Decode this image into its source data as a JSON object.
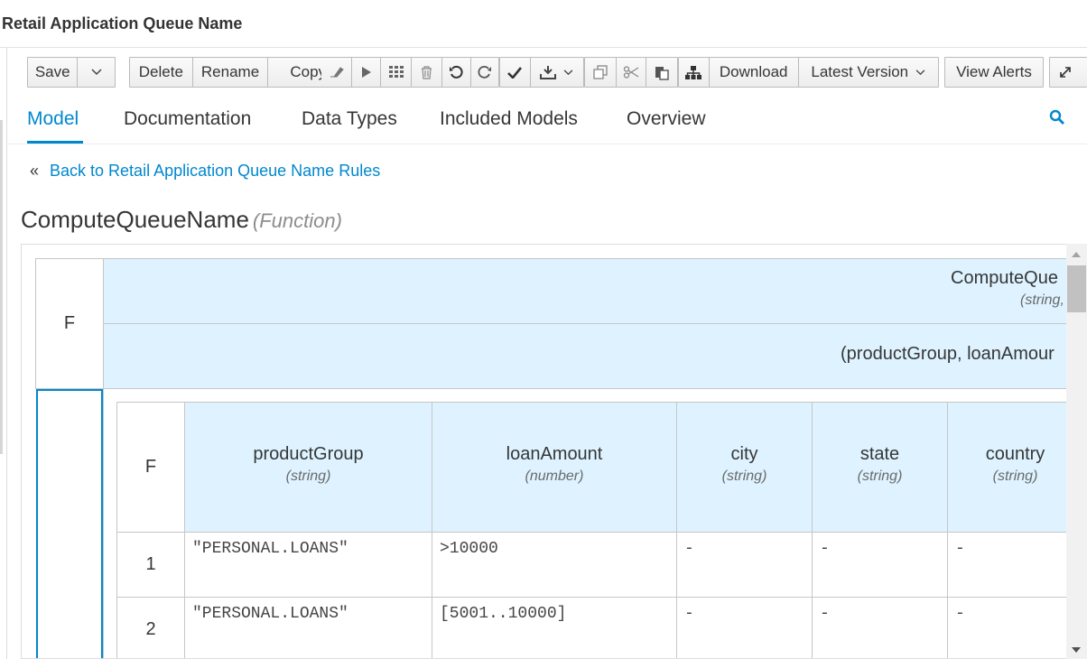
{
  "app": {
    "title": "Retail Application Queue Name"
  },
  "toolbar": {
    "save": "Save",
    "delete": "Delete",
    "rename": "Rename",
    "copy": "Copy",
    "download": "Download",
    "latest_version": "Latest Version",
    "view_alerts": "View Alerts"
  },
  "tabs": [
    {
      "label": "Model",
      "active": true
    },
    {
      "label": "Documentation"
    },
    {
      "label": "Data Types"
    },
    {
      "label": "Included Models"
    },
    {
      "label": "Overview"
    }
  ],
  "back_link": {
    "icon": "«",
    "label": "Back to Retail Application Queue Name Rules"
  },
  "function": {
    "name": "ComputeQueueName",
    "kind": "(Function)"
  },
  "editor": {
    "outer_hit_policy": "F",
    "outer_name": "ComputeQue",
    "outer_type": "(string,",
    "params": "(productGroup, loanAmour",
    "inner_hit_policy": "F",
    "columns": [
      {
        "name": "productGroup",
        "type": "(string)"
      },
      {
        "name": "loanAmount",
        "type": "(number)"
      },
      {
        "name": "city",
        "type": "(string)"
      },
      {
        "name": "state",
        "type": "(string)"
      },
      {
        "name": "country",
        "type": "(string)"
      }
    ],
    "rows": [
      {
        "index": "1",
        "cells": [
          "\"PERSONAL.LOANS\"",
          ">10000",
          "-",
          "-",
          "-"
        ]
      },
      {
        "index": "2",
        "cells": [
          "\"PERSONAL.LOANS\"",
          "[5001..10000]",
          "-",
          "-",
          "-"
        ]
      }
    ]
  },
  "colors": {
    "accent": "#0088ce",
    "header_bg": "#def3ff",
    "selection": "#0088ce"
  }
}
